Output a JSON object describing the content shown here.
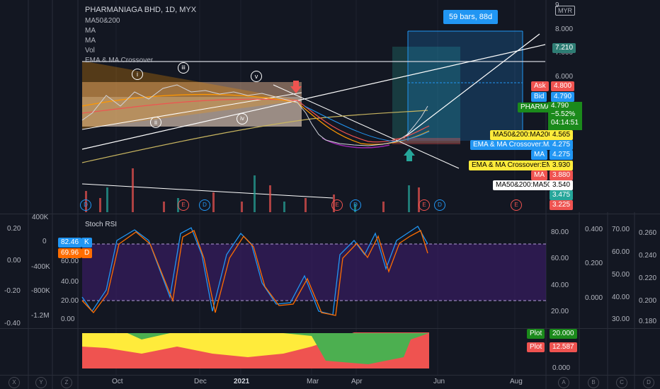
{
  "header": {
    "title": "PHARMANIAGA BHD, 1D, MYX",
    "indicators": [
      "MA50&200",
      "MA",
      "MA",
      "Vol",
      "EMA & MA Crossover"
    ],
    "currency": "MYR"
  },
  "range_tooltip": "59 bars, 88d",
  "price_axis": {
    "ticks": [
      "9",
      "8.000",
      "7.000",
      "6.000"
    ]
  },
  "price_labels": [
    {
      "text": "7.210",
      "bg": "#2e7d74"
    },
    {
      "text": "Ask",
      "bg": "#ef5350",
      "value": "4.800"
    },
    {
      "text": "Bid",
      "bg": "#2196f3",
      "value": "4.790"
    },
    {
      "text": "PHARMA",
      "bg": "#1b8a1b",
      "value": "4.790",
      "change": "−5.52%",
      "timer": "04:14:51"
    },
    {
      "text": "MA50&200:MA200",
      "bg": "#ffeb3b",
      "value": "4.565"
    },
    {
      "text": "EMA & MA Crossover:MA",
      "bg": "#2196f3",
      "value": "4.275"
    },
    {
      "text": "MA",
      "bg": "#2196f3",
      "value": "4.275"
    },
    {
      "text": "EMA & MA Crossover:EMA",
      "bg": "#ffeb3b",
      "value": "3.930"
    },
    {
      "text": "MA",
      "bg": "#ef5350",
      "value": "3.880"
    },
    {
      "text": "MA50&200:MA50",
      "bg": "#ffffff",
      "value": "3.540"
    },
    {
      "text": "",
      "bg": "#26a69a",
      "value": "3.475"
    },
    {
      "text": "",
      "bg": "#ef5350",
      "value": "3.225"
    }
  ],
  "wave_labels": [
    "i",
    "ii",
    "iii",
    "iv",
    "v"
  ],
  "events": [
    "D",
    "E",
    "D",
    "E",
    "D",
    "E",
    "D",
    "E"
  ],
  "stoch": {
    "title": "Stoch RSI",
    "k_value": "82.46",
    "k_label": "K",
    "d_value": "69.96",
    "d_label": "D",
    "ticks": [
      "80.00",
      "60.00",
      "40.00",
      "20.00",
      "0.00"
    ],
    "left_ticks_a": [
      "400K",
      "0",
      "-400K",
      "-800K",
      "-1.2M"
    ],
    "left_ticks_b": [
      "0.20",
      "0.00",
      "-0.20",
      "-0.40"
    ],
    "right_ticks_a": [
      "0.400",
      "0.200",
      "0.000"
    ],
    "right_ticks_b": [
      "70.00",
      "60.00",
      "50.00",
      "40.00",
      "30.00"
    ],
    "right_ticks_c": [
      "0.260",
      "0.240",
      "0.220",
      "0.200",
      "0.180"
    ],
    "right_ticks_d": [
      "80.00",
      "60.00",
      "40.00",
      "20.00"
    ]
  },
  "plot_pane": {
    "plot1_label": "Plot",
    "plot1_value": "20.000",
    "plot2_label": "Plot",
    "plot2_value": "12.587",
    "tick_zero": "0.000"
  },
  "time_axis": [
    "Oct",
    "Dec",
    "2021",
    "Mar",
    "Apr",
    "Jun",
    "Aug"
  ],
  "bottom_letters": [
    "X",
    "Y",
    "Z",
    "A",
    "B",
    "C",
    "D"
  ],
  "colors": {
    "bg": "#131722",
    "up": "#26a69a",
    "down": "#ef5350",
    "k_line": "#2196f3",
    "d_line": "#ff6d00",
    "stoch_fill": "#3d1d6d"
  }
}
